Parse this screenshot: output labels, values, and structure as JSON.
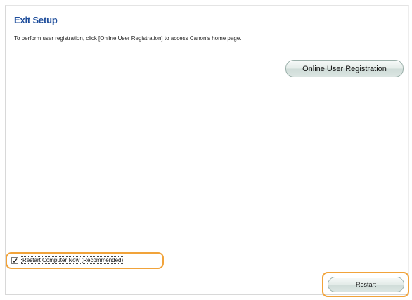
{
  "dialog": {
    "title": "Exit Setup",
    "description": "To perform user registration, click [Online User Registration] to access Canon's home page.",
    "online_registration_label": "Online User Registration",
    "restart_checkbox_label": "Restart Computer Now (Recommended)",
    "restart_checkbox_checked": true,
    "restart_button_label": "Restart"
  },
  "colors": {
    "title": "#1f4e9c",
    "highlight": "#f1a33a"
  }
}
